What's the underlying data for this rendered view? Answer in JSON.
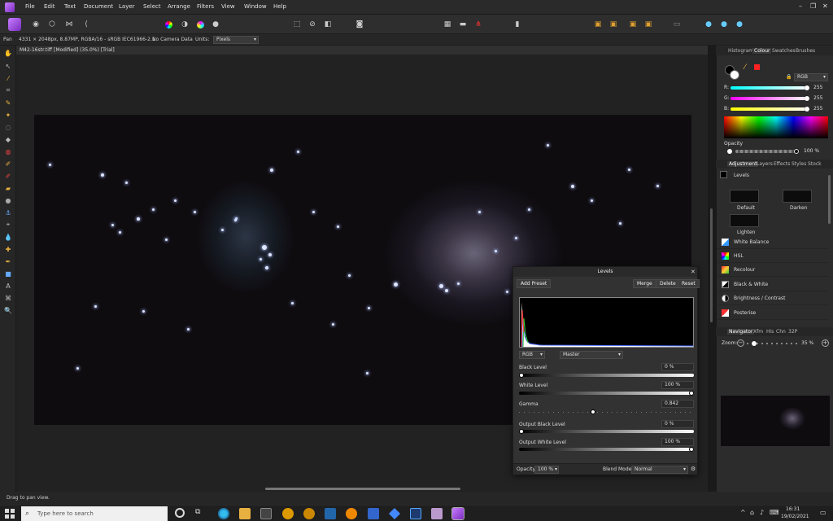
{
  "menu": [
    "File",
    "Edit",
    "Text",
    "Document",
    "Layer",
    "Select",
    "Arrange",
    "Filters",
    "View",
    "Window",
    "Help"
  ],
  "window_controls": {
    "minimize": "–",
    "restore": "❐",
    "close": "✕"
  },
  "context_bar": {
    "tool": "Pan",
    "image_info": "4331 × 2048px, 8.87MP, RGBA/16 - sRGB IEC61966-2.1",
    "camera": "No Camera Data",
    "units_label": "Units:",
    "units_value": "Pixels"
  },
  "document": {
    "tab_title": "M42-16str.tiff [Modified] (35.0%) [Trial]"
  },
  "status": {
    "text": "Drag to pan view."
  },
  "panels": {
    "colour_tabs": [
      "Histogram",
      "Colour",
      "Swatches",
      "Brushes"
    ],
    "colour_mode": "RGB",
    "r": "255",
    "g": "255",
    "b": "255",
    "r_label": "R:",
    "g_label": "G:",
    "b_label": "B:",
    "opacity_label": "Opacity",
    "opacity_value": "100 %",
    "adjust_tabs": [
      "Adjustment",
      "Layers",
      "Effects",
      "Styles",
      "Stock"
    ],
    "levels_title": "Levels",
    "presets": [
      "Default",
      "Darken",
      "Lighten"
    ],
    "adjust_items": [
      "White Balance",
      "HSL",
      "Recolour",
      "Black & White",
      "Brightness / Contrast",
      "Posterise"
    ],
    "nav_tabs": [
      "Navigator",
      "Xfm",
      "His",
      "Chn",
      "32P"
    ],
    "zoom_label": "Zoom:",
    "zoom_value": "35 %"
  },
  "levels_dialog": {
    "title": "Levels",
    "add_preset": "Add Preset",
    "merge": "Merge",
    "delete": "Delete",
    "reset": "Reset",
    "channel_mode": "RGB",
    "channel": "Master",
    "black_level_label": "Black Level",
    "black_level": "0 %",
    "white_level_label": "White Level",
    "white_level": "100 %",
    "gamma_label": "Gamma",
    "gamma": "0.842",
    "out_black_label": "Output Black Level",
    "out_black": "0 %",
    "out_white_label": "Output White Level",
    "out_white": "100 %",
    "opacity_label": "Opacity:",
    "opacity": "100 %",
    "blend_label": "Blend Mode:",
    "blend": "Normal"
  },
  "taskbar": {
    "search_placeholder": "Type here to search",
    "time": "16:31",
    "date": "19/02/2021"
  },
  "colors": {
    "accent": "#a64dff",
    "red": "#ff2a2a"
  }
}
